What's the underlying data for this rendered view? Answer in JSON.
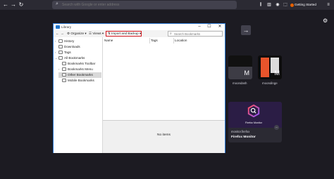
{
  "browser": {
    "url_placeholder": "Search with Google or enter address",
    "getting_started": "Getting Started",
    "tiles": [
      {
        "label": "moondash",
        "letter": "M"
      },
      {
        "label": "moondinge",
        "letter": "M"
      }
    ],
    "highlight": {
      "image_text": "Firefox Monitor",
      "source": "monitor.firefox",
      "title": "Firefox Monitor"
    }
  },
  "library": {
    "title": "Library",
    "organize_label": "Organize",
    "views_label": "Views",
    "import_label": "Import and Backup",
    "search_placeholder": "Search Bookmarks",
    "tree": [
      {
        "label": "History"
      },
      {
        "label": "Downloads"
      },
      {
        "label": "Tags"
      },
      {
        "label": "All Bookmarks"
      },
      {
        "label": "Bookmarks Toolbar"
      },
      {
        "label": "Bookmarks Menu"
      },
      {
        "label": "Other Bookmarks",
        "selected": true
      },
      {
        "label": "Mobile Bookmarks"
      }
    ],
    "columns": [
      "Name",
      "Tags",
      "Location"
    ],
    "empty_text": "No items"
  }
}
